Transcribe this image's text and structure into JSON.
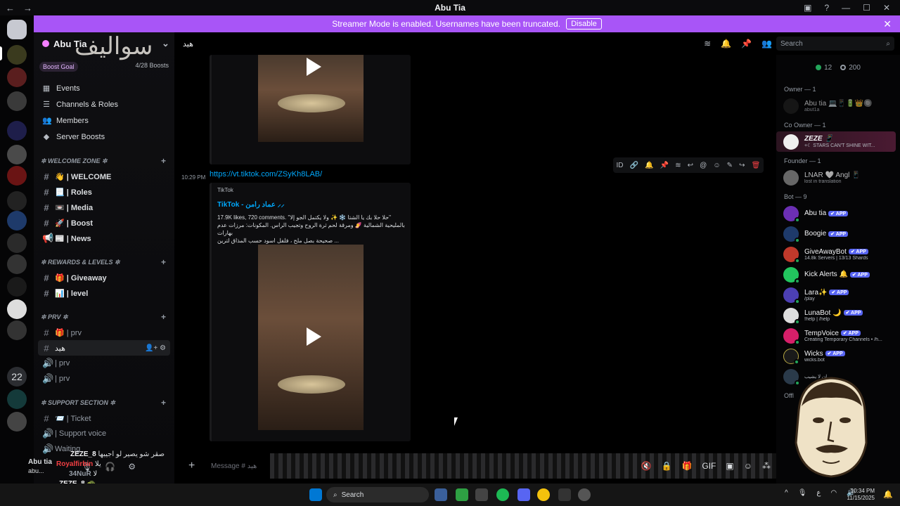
{
  "window": {
    "title": "Abu Tia",
    "back": "←",
    "forward": "→"
  },
  "banner": {
    "text": "Streamer Mode is enabled. Usernames have been truncated.",
    "button": "Disable"
  },
  "server": {
    "name": "Abu Tia",
    "calligraphy": "سواليف",
    "boost_label": "Boost Goal",
    "boost_progress": "4/28 Boosts",
    "menu": [
      {
        "icon": "calendar-icon",
        "label": "Events"
      },
      {
        "icon": "list-icon",
        "label": "Channels & Roles"
      },
      {
        "icon": "members-icon",
        "label": "Members"
      },
      {
        "icon": "boost-icon",
        "label": "Server Boosts"
      }
    ],
    "categories": [
      {
        "name": "✲ WELCOME ZONE ✲",
        "channels": [
          {
            "type": "#",
            "label": "👋 | WELCOME",
            "bright": true
          },
          {
            "type": "#",
            "label": "📃 | Roles",
            "bright": true
          },
          {
            "type": "#",
            "label": "📼 | Media",
            "bright": true
          },
          {
            "type": "#",
            "label": "🚀 | Boost",
            "bright": true
          },
          {
            "type": "📢",
            "label": "📰 | News",
            "bright": true
          }
        ]
      },
      {
        "name": "✲ REWARDS & LEVELS ✲",
        "channels": [
          {
            "type": "#",
            "label": "🎁 | Giveaway",
            "bright": true
          },
          {
            "type": "#",
            "label": "📊 | level",
            "bright": true
          }
        ]
      },
      {
        "name": "✲ PRV ✲",
        "channels": [
          {
            "type": "#",
            "label": "🎁 | prv",
            "bright": false
          },
          {
            "type": "#",
            "label": "هيد",
            "bright": false,
            "active": true
          },
          {
            "type": "🔊",
            "label": "| prv",
            "bright": false
          },
          {
            "type": "🔊",
            "label": "| prv",
            "bright": false
          }
        ]
      },
      {
        "name": "✲ SUPPORT SECTION ✲",
        "channels": [
          {
            "type": "#",
            "label": "📨 | Ticket",
            "bright": false
          },
          {
            "type": "🔊",
            "label": "| Support voice",
            "bright": false
          },
          {
            "type": "🔊",
            "label": "Waiting",
            "bright": false
          }
        ]
      }
    ]
  },
  "channel": {
    "name": "هيد"
  },
  "search": {
    "placeholder": "Search"
  },
  "messages": {
    "timestamp": "10:29 PM",
    "link": "https://vt.tiktok.com/ZSyKh8LAB/",
    "embed": {
      "provider": "TikTok",
      "title": "TikTok - عماد رامن ⸝⸝",
      "description_1": "17.9K likes, 720 comments. \"حلا حلا بك يا الشتا ❄️ ✨ ولا يكتمل الجو إلا\"",
      "description_2": "بالمليحية الشمالية 🍠 ومرقة لحم ثرة الروح وتجيب الراس. المكونات: مرزات عدم بهارات",
      "description_3": "صحيحة بصل ملح ، فلفل اسود حسب المذاق لترين ..."
    }
  },
  "members": {
    "online": "12",
    "total": "200",
    "groups": [
      {
        "role": "Owner — 1",
        "list": [
          {
            "name": "Abu tia",
            "badges": "💻📱🔋👑🔘",
            "sub": "abut1a",
            "dim": true
          }
        ]
      },
      {
        "role": "Co Owner — 1",
        "list": [
          {
            "name": "ZEZE",
            "badges": "📱",
            "sub": "+☾ STARS CAN'T SHINE WIT...",
            "highlight": true
          }
        ]
      },
      {
        "role": "Founder — 1",
        "list": [
          {
            "name": "LNAR",
            "badges": "🤍 Angl 📱",
            "sub": "lost in translation",
            "dim": true
          }
        ]
      },
      {
        "role": "Bot — 9",
        "list": [
          {
            "name": "Abu tia",
            "app": "✔ APP",
            "sub": ""
          },
          {
            "name": "Boogie",
            "app": "✔ APP",
            "sub": ""
          },
          {
            "name": "GiveAwayBot",
            "app": "✔ APP",
            "sub": "14.8k Servers | 13/13 Shards"
          },
          {
            "name": "Kick Alerts 🔔",
            "app": "✔ APP",
            "sub": ""
          },
          {
            "name": "Lara✨",
            "app": "✔ APP",
            "sub": "/play"
          },
          {
            "name": "LunaBot 🌙",
            "app": "✔ APP",
            "sub": "!help | /help"
          },
          {
            "name": "TempVoice",
            "app": "✔ APP",
            "sub": "Creating Temporary Channels • /h..."
          },
          {
            "name": "Wicks",
            "app": "✔ APP",
            "sub": "wicks.bot"
          },
          {
            "name": "",
            "app": "",
            "sub": "ان لا يشيب ..."
          }
        ]
      }
    ],
    "offline_label": "Offl"
  },
  "composer": {
    "placeholder": "Message # هيد"
  },
  "user": {
    "name": "Abu tia",
    "sub": "abu..."
  },
  "overlay_chat": {
    "line1_name": "ZEZE_8",
    "line1_text": "صقر شو يصير لو اجيبها",
    "line2_name": "Royalfirbin",
    "line2_text": "يلا",
    "line3_name": "34NuR",
    "line3_text": "لا",
    "line4_name": "ZEZE_8",
    "line4_text": "🐢"
  },
  "taskbar": {
    "search": "Search",
    "time": "10:34 PM",
    "date": "11/15/2025",
    "lang": "ع"
  },
  "colors": {
    "accent": "#a855f7",
    "link": "#00a8fc",
    "online": "#23a55a",
    "danger": "#f23f43",
    "app_badge": "#5865f2"
  }
}
